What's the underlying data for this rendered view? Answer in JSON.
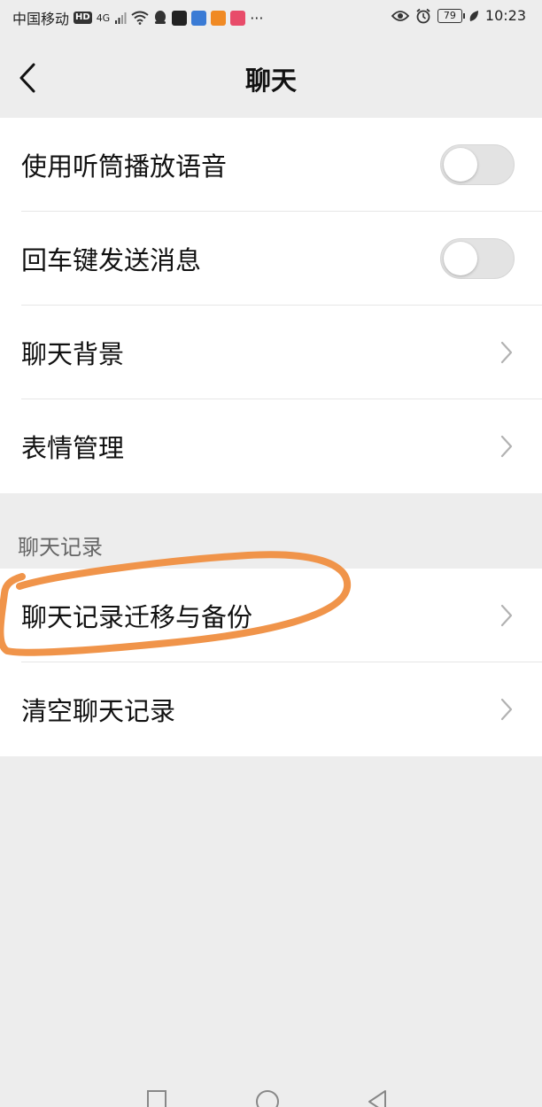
{
  "status_bar": {
    "carrier": "中国移动",
    "hd": "HD",
    "network": "4G",
    "battery": "79",
    "time": "10:23",
    "more": "···"
  },
  "header": {
    "title": "聊天"
  },
  "settings_group1": [
    {
      "label": "使用听筒播放语音",
      "control": "toggle",
      "value": "off"
    },
    {
      "label": "回车键发送消息",
      "control": "toggle",
      "value": "off"
    },
    {
      "label": "聊天背景",
      "control": "chevron"
    },
    {
      "label": "表情管理",
      "control": "chevron"
    }
  ],
  "section_chat_history": {
    "header": "聊天记录",
    "items": [
      {
        "label": "聊天记录迁移与备份",
        "control": "chevron"
      },
      {
        "label": "清空聊天记录",
        "control": "chevron"
      }
    ]
  },
  "colors": {
    "background": "#ededed",
    "card": "#ffffff",
    "toggle_off": "#e3e3e3",
    "annotation": "#f0944a"
  }
}
